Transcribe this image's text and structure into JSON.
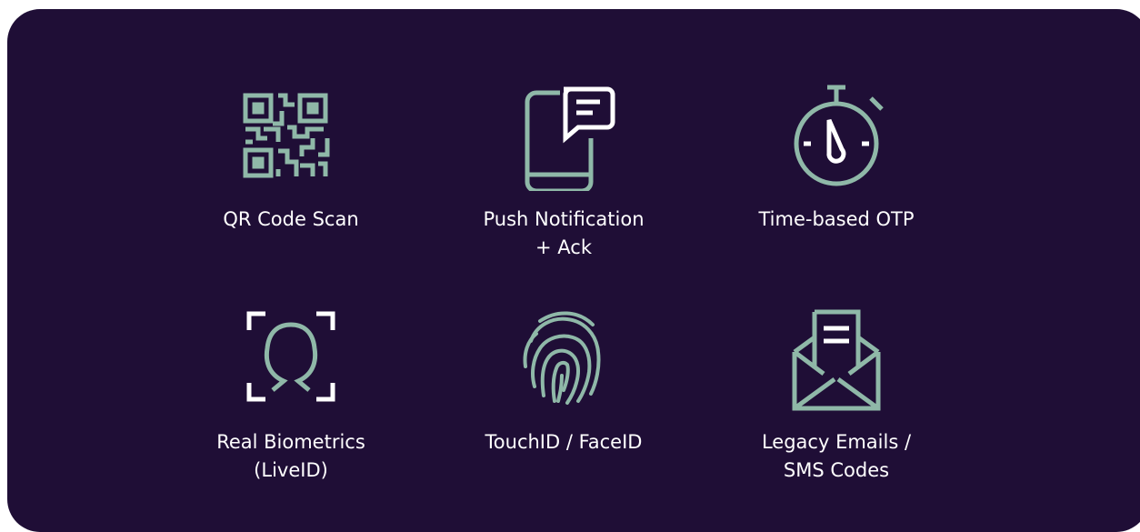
{
  "colors": {
    "background": "#1f0e36",
    "icon_accent": "#8fb8a8",
    "icon_white": "#ffffff",
    "text": "#ffffff"
  },
  "methods": [
    {
      "icon": "qr-code-icon",
      "label_lines": [
        "QR Code Scan"
      ]
    },
    {
      "icon": "phone-message-icon",
      "label_lines": [
        "Push Notification",
        "+ Ack"
      ]
    },
    {
      "icon": "stopwatch-icon",
      "label_lines": [
        "Time-based OTP"
      ]
    },
    {
      "icon": "face-scan-icon",
      "label_lines": [
        "Real Biometrics",
        "(LiveID)"
      ]
    },
    {
      "icon": "fingerprint-icon",
      "label_lines": [
        "TouchID / FaceID"
      ]
    },
    {
      "icon": "envelope-icon",
      "label_lines": [
        "Legacy Emails /",
        "SMS Codes"
      ]
    }
  ]
}
